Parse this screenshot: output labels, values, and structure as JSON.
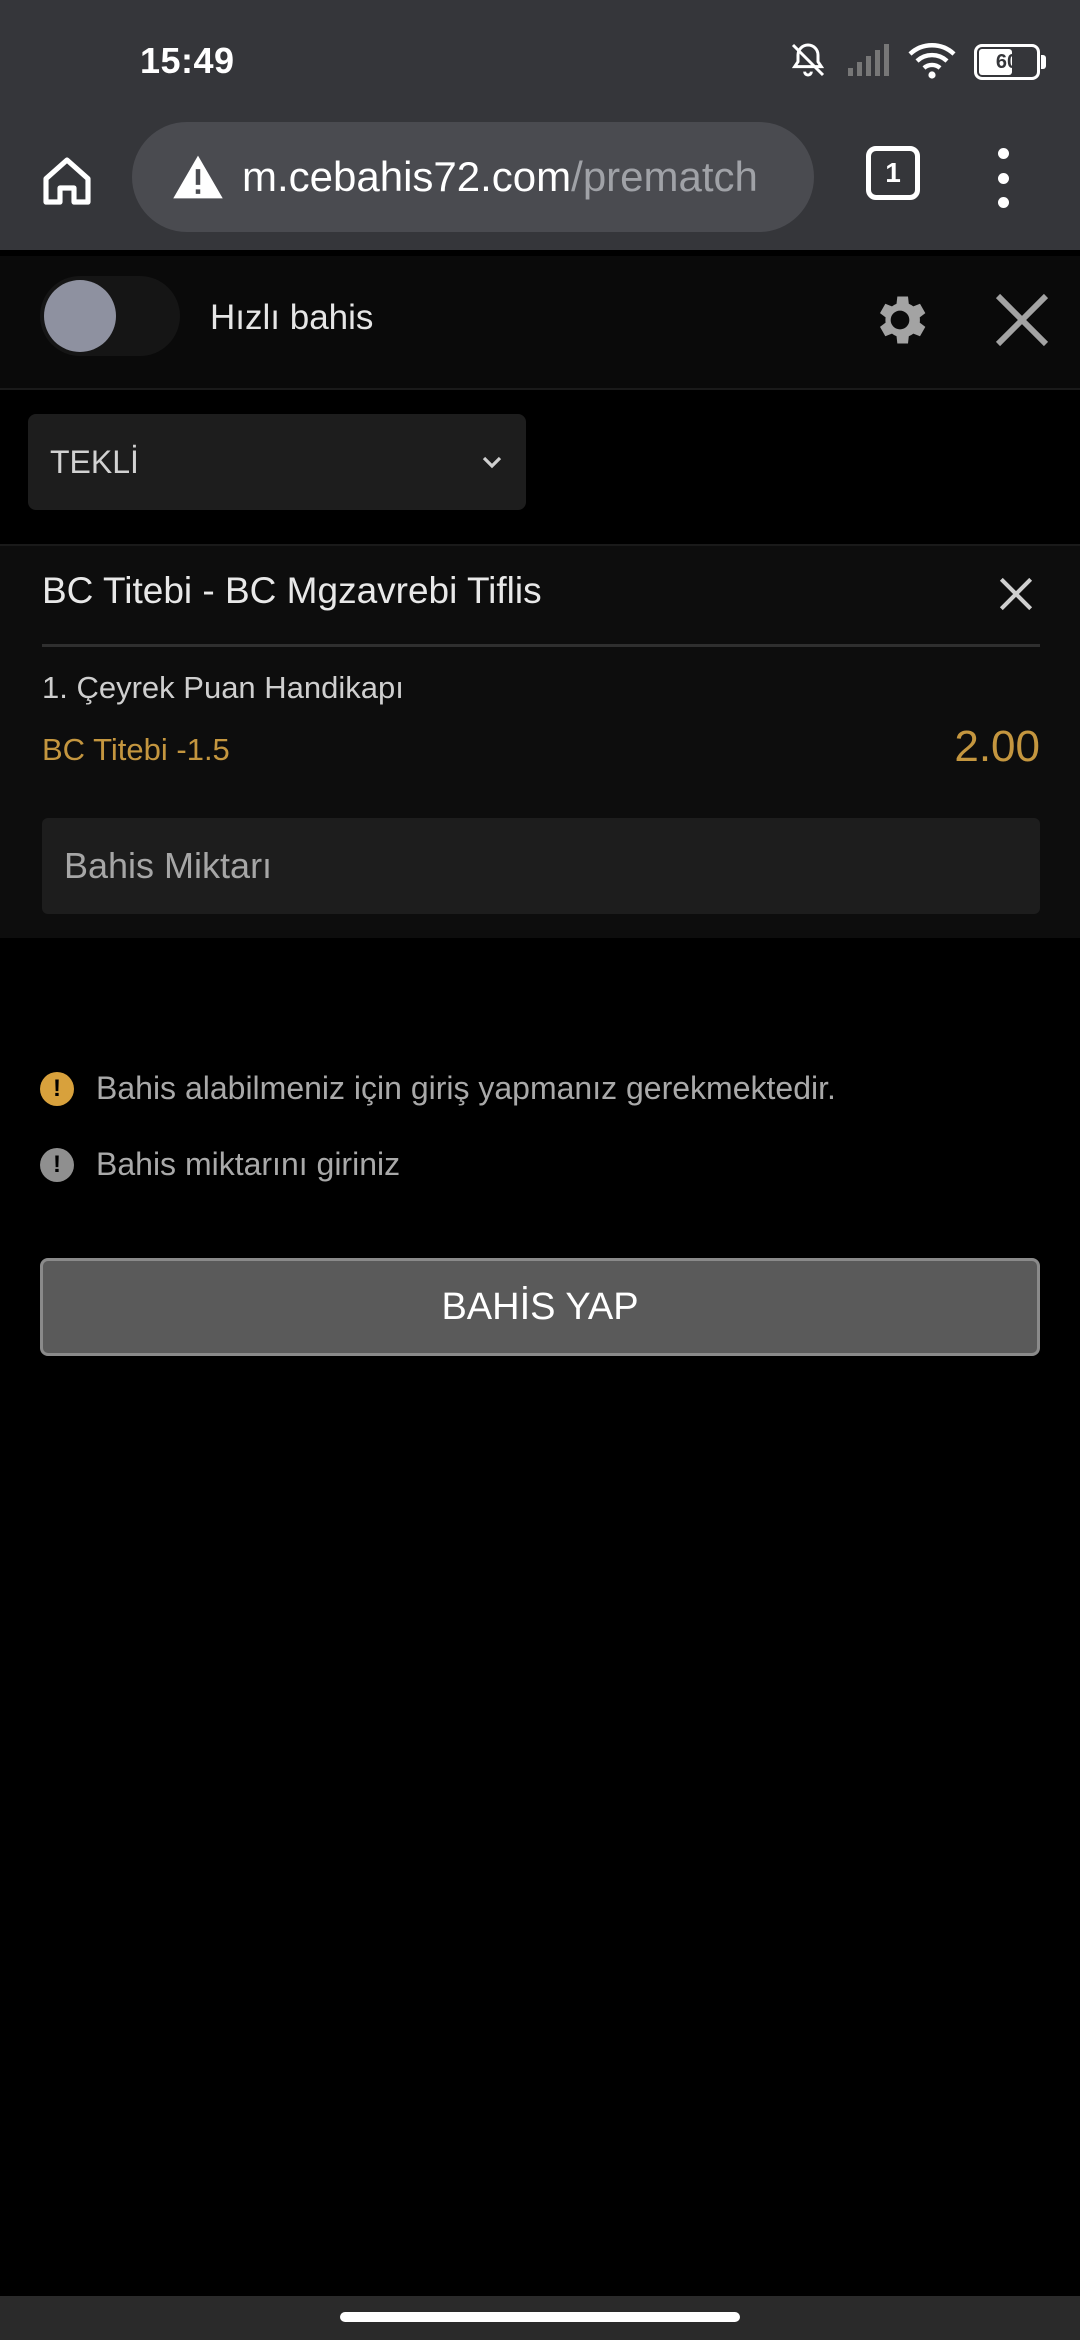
{
  "status_bar": {
    "time": "15:49",
    "battery": "60",
    "icons": [
      "bell-muted-icon",
      "signal-icon",
      "wifi-icon",
      "battery-icon"
    ]
  },
  "browser": {
    "url_host": "m.cebahis72.com",
    "url_path": "/prematch",
    "tab_count": "1",
    "icons": [
      "home-icon",
      "warning-icon",
      "tabs-icon",
      "more-vert-icon"
    ]
  },
  "header": {
    "quick_bet_label": "Hızlı bahis",
    "quick_bet_enabled": false,
    "icons": [
      "gear-icon",
      "close-icon"
    ]
  },
  "bet_type": {
    "selected": "TEKLİ",
    "icon": "chevron-down-icon"
  },
  "bet": {
    "match": "BC Titebi - BC Mgzavrebi Tiflis",
    "market": "1. Çeyrek Puan Handikapı",
    "selection": "BC Titebi -1.5",
    "odds": "2.00",
    "stake_placeholder": "Bahis Miktarı"
  },
  "messages": {
    "login_required": "Bahis alabilmeniz için giriş yapmanız gerekmektedir.",
    "enter_amount": "Bahis miktarını giriniz"
  },
  "actions": {
    "place_bet": "BAHİS YAP"
  },
  "colors": {
    "accent": "#c4963f",
    "warning": "#d8a13c",
    "background": "#000000",
    "chrome": "#35363a"
  }
}
